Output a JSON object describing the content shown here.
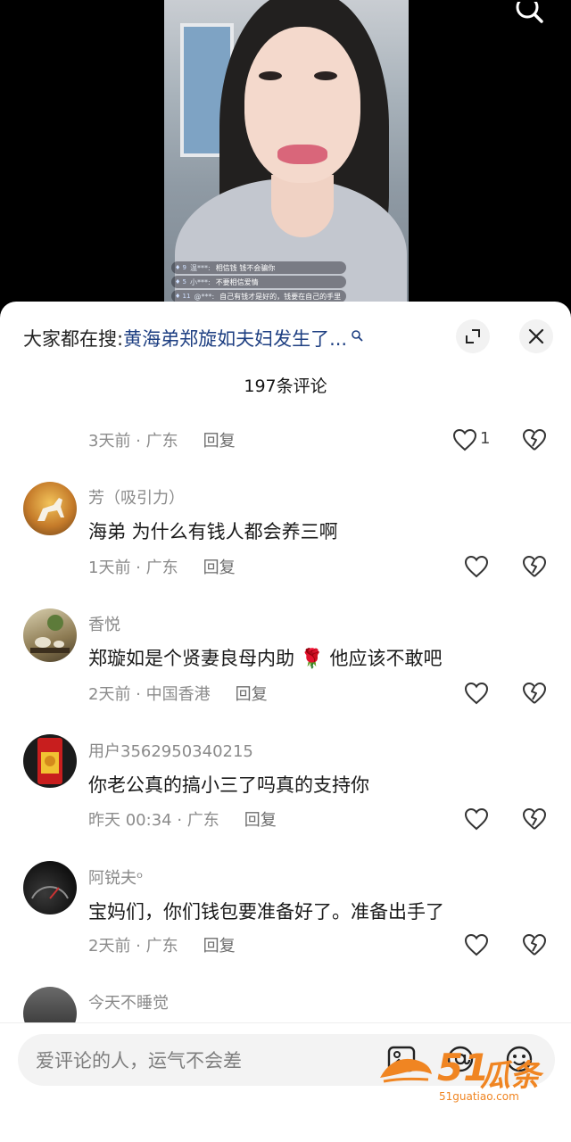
{
  "video": {
    "chat_messages": [
      {
        "level": "9",
        "user": "温***:",
        "text": "相信钱 钱不会骗你"
      },
      {
        "level": "5",
        "user": "小***:",
        "text": "不要相信爱情"
      },
      {
        "level": "11",
        "user": "@***:",
        "text": "自己有钱才是好的，钱要在自己的手里"
      }
    ]
  },
  "sheet": {
    "hot_search_prefix": "大家都在搜:",
    "hot_search_link": "黄海弟郑旋如夫妇发生了...",
    "comment_count": "197条评论"
  },
  "top_meta": {
    "time": "3天前 · 广东",
    "reply": "回复",
    "likes": "1"
  },
  "comments": [
    {
      "name": "芳（吸引力）",
      "text": "海弟 为什么有钱人都会养三啊",
      "time": "1天前 · 广东",
      "reply": "回复"
    },
    {
      "name": "香悦",
      "text": "郑璇如是个贤妻良母内助",
      "text_after": "他应该不敢吧",
      "emoji": "🌹",
      "time": "2天前 · 中国香港",
      "reply": "回复"
    },
    {
      "name": "用户3562950340215",
      "text": "你老公真的搞小三了吗真的支持你",
      "time": "昨天 00:34 · 广东",
      "reply": "回复"
    },
    {
      "name": "阿锐夫ᵒ",
      "text": "宝妈们，你们钱包要准备好了。准备出手了",
      "time": "2天前 · 广东",
      "reply": "回复"
    },
    {
      "name": "今天不睡觉",
      "text": "",
      "time": "",
      "reply": ""
    }
  ],
  "input": {
    "placeholder": "爱评论的人，运气不会差"
  },
  "watermark": {
    "num": "51",
    "cn": "瓜条",
    "url": "51guatiao.com"
  },
  "colors": {
    "link": "#1e3f82",
    "accent": "#f08522"
  }
}
